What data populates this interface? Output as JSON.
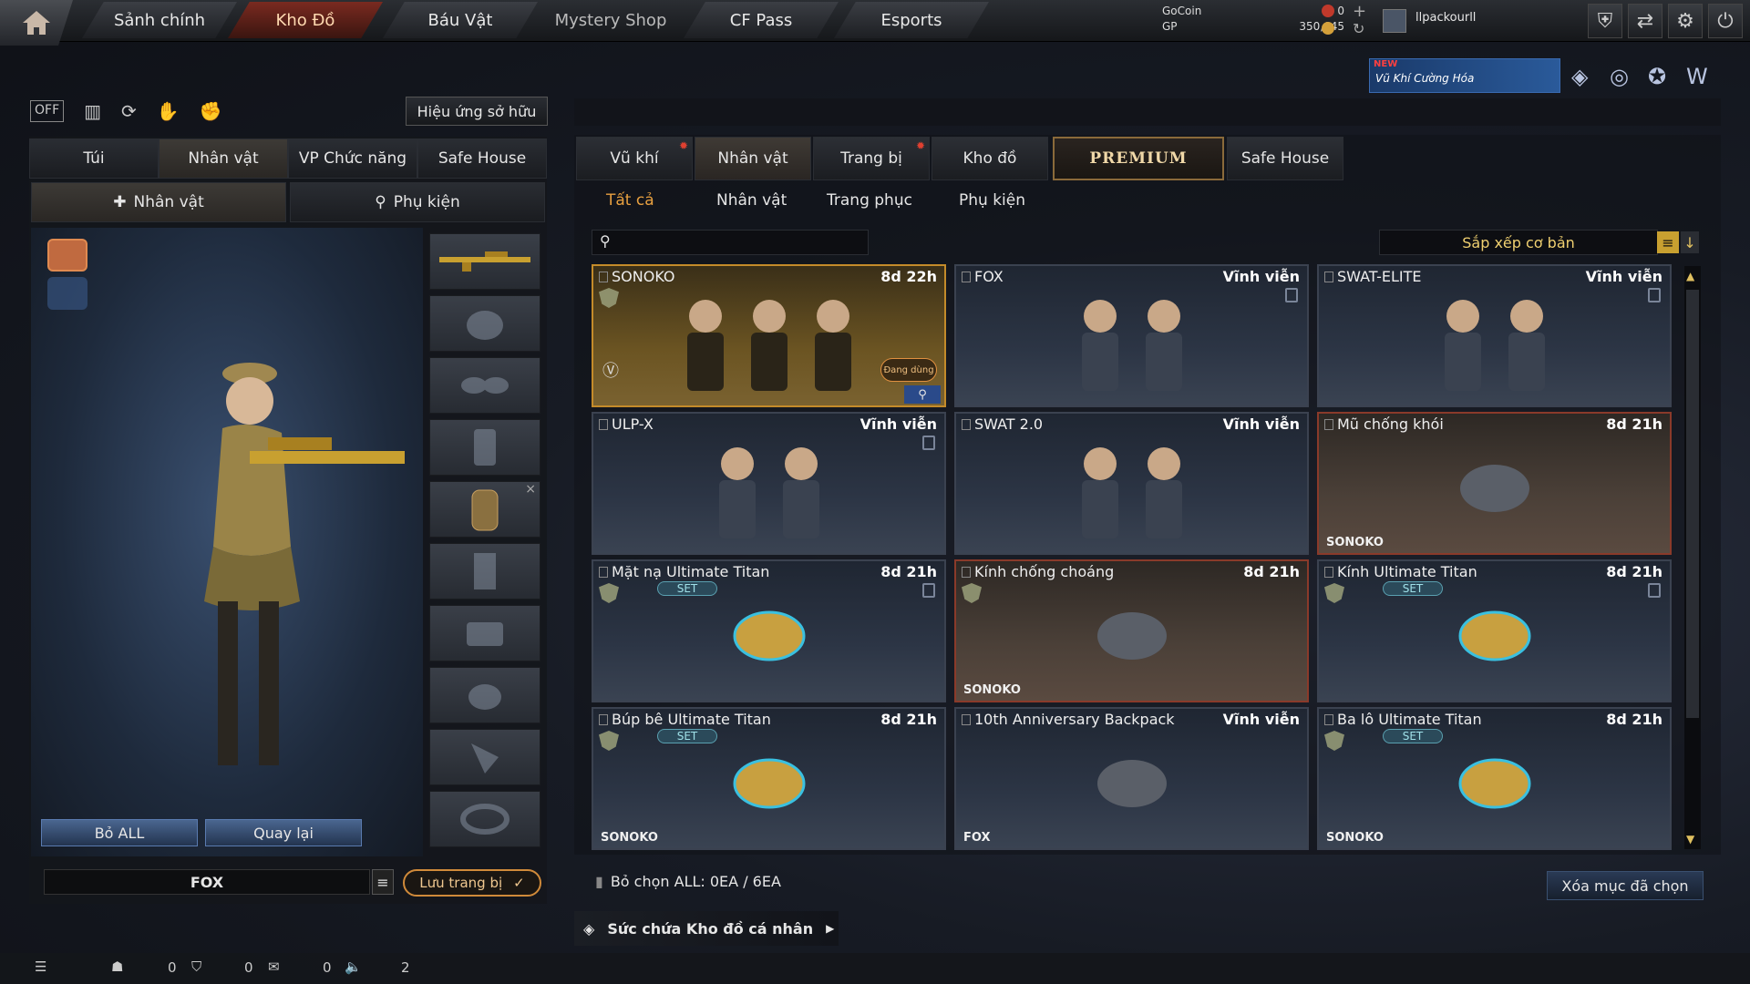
{
  "nav": {
    "tabs": [
      "Sảnh chính",
      "Kho Đồ",
      "Báu Vật",
      "Mystery Shop",
      "CF Pass",
      "Esports"
    ],
    "active": "Kho Đồ"
  },
  "currency": {
    "gocoin_label": "GoCoin",
    "gp_label": "GP",
    "gocoin_value": "0",
    "gp_value": "350,645"
  },
  "user": {
    "name": "llpackourll"
  },
  "banner": {
    "new_label": "NEW",
    "text": "Vũ Khí Cường Hóa"
  },
  "left": {
    "owned_effects_btn": "Hiệu ứng sở hữu",
    "tabs": [
      "Túi",
      "Nhân vật",
      "VP Chức năng",
      "Safe House"
    ],
    "subtabs": [
      "Nhân vật",
      "Phụ kiện"
    ],
    "drop_all": "Bỏ ALL",
    "back": "Quay lại",
    "preset_name": "FOX",
    "save_equip": "Lưu trang bị"
  },
  "right": {
    "tabs": [
      "Vũ khí",
      "Nhân vật",
      "Trang bị",
      "Kho đồ",
      "PREMIUM",
      "Safe House"
    ],
    "filters": [
      "Tất cả",
      "Nhân vật",
      "Trang phục",
      "Phụ kiện"
    ],
    "search_placeholder": "",
    "sort_label": "Sắp xếp cơ bản",
    "cards": [
      {
        "name": "SONOKO",
        "duration": "8d 22h",
        "owner": "",
        "in_use": "Đang dùng"
      },
      {
        "name": "FOX",
        "duration": "Vĩnh viễn",
        "owner": ""
      },
      {
        "name": "SWAT-ELITE",
        "duration": "Vĩnh viễn",
        "owner": ""
      },
      {
        "name": "ULP-X",
        "duration": "Vĩnh viễn",
        "owner": ""
      },
      {
        "name": "SWAT 2.0",
        "duration": "Vĩnh viễn",
        "owner": ""
      },
      {
        "name": "Mũ chống khói",
        "duration": "8d 21h",
        "owner": "SONOKO"
      },
      {
        "name": "Mặt nạ Ultimate Titan",
        "duration": "8d 21h",
        "owner": "",
        "set": "SET"
      },
      {
        "name": "Kính chống choáng",
        "duration": "8d 21h",
        "owner": "SONOKO"
      },
      {
        "name": "Kính Ultimate Titan",
        "duration": "8d 21h",
        "owner": "",
        "set": "SET"
      },
      {
        "name": "Búp bê Ultimate Titan",
        "duration": "8d 21h",
        "owner": "SONOKO",
        "set": "SET"
      },
      {
        "name": "10th Anniversary Backpack",
        "duration": "Vĩnh viễn",
        "owner": "FOX"
      },
      {
        "name": "Ba lô Ultimate Titan",
        "duration": "8d 21h",
        "owner": "SONOKO",
        "set": "SET"
      }
    ],
    "deselect_all": "Bỏ chọn ALL: 0EA / 6EA",
    "delete_selected": "Xóa mục đã chọn",
    "capacity": "Sức chứa Kho đồ cá nhân"
  },
  "status": {
    "a": "0",
    "b": "0",
    "c": "0",
    "d": "2"
  },
  "colors": {
    "accent": "#c48b2a",
    "active_tab": "#7a2a20",
    "blue_btn": "#4a6690"
  }
}
